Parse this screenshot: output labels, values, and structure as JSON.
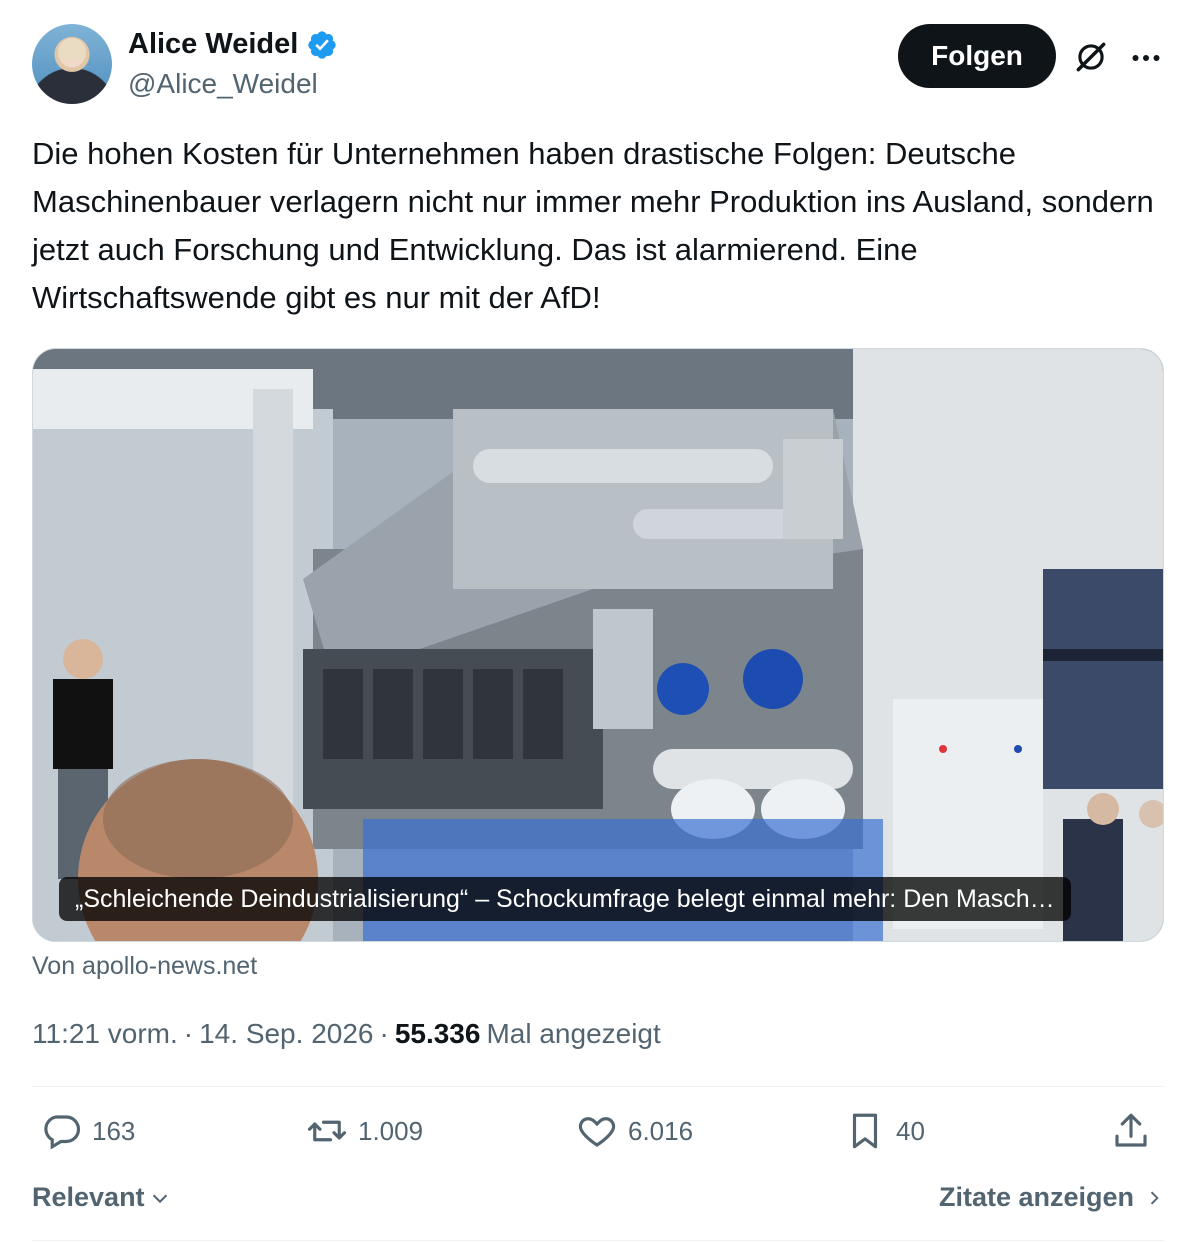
{
  "author": {
    "name": "Alice Weidel",
    "handle": "@Alice_Weidel",
    "verified": true,
    "verified_color": "#1d9bf0"
  },
  "follow_button": {
    "label": "Folgen"
  },
  "icons": {
    "grok": "grok-icon",
    "more": "more-icon"
  },
  "tweet": {
    "text": "Die hohen Kosten für Unternehmen haben drastische Folgen: Deutsche Maschinenbauer verlagern nicht nur immer mehr Produktion ins Ausland, sondern jetzt auch Forschung und Entwicklung. Das ist alarmierend. Eine Wirtschaftswende gibt es nur mit der AfD!"
  },
  "link_card": {
    "caption": "„Schleichende Deindustrialisierung“ – Schockumfrage belegt einmal mehr: Den Masch…",
    "source": "Von apollo-news.net"
  },
  "meta": {
    "time": "11:21 vorm.",
    "separator": "·",
    "date": "14. Sep. 2026",
    "views_count": "55.336",
    "views_label": "Mal angezeigt"
  },
  "actions": {
    "replies": "163",
    "reposts": "1.009",
    "likes": "6.016",
    "bookmarks": "40"
  },
  "footer": {
    "sort_label": "Relevant",
    "quotes_label": "Zitate anzeigen"
  }
}
